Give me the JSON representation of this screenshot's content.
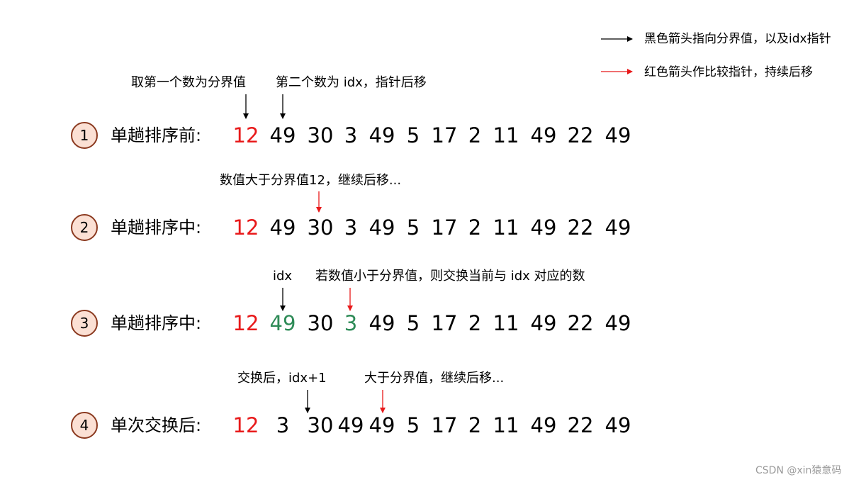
{
  "colors": {
    "pivot": "#e8191a",
    "swap": "#2e8b57",
    "black_arrow": "#000000",
    "red_arrow": "#e8191a",
    "circle_fill": "#fbe0d4",
    "circle_border": "#8b3a20"
  },
  "legend": {
    "black": "黑色箭头指向分界值，以及idx指针",
    "red": "红色箭头作比较指针，持续后移"
  },
  "annotations": {
    "row1_pivot": "取第一个数为分界值",
    "row1_idx": "第二个数为 idx，指针后移",
    "row2_compare": "数值大于分界值12，继续后移...",
    "row3_idx": "idx",
    "row3_compare": "若数值小于分界值，则交换当前与 idx 对应的数",
    "row4_idx": "交换后，idx+1",
    "row4_compare": "大于分界值，继续后移..."
  },
  "rows": [
    {
      "step": "1",
      "label": "单趟排序前:",
      "numbers": [
        "12",
        "49",
        "30",
        "3",
        "49",
        "5",
        "17",
        "2",
        "11",
        "49",
        "22",
        "49"
      ]
    },
    {
      "step": "2",
      "label": "单趟排序中:",
      "numbers": [
        "12",
        "49",
        "30",
        "3",
        "49",
        "5",
        "17",
        "2",
        "11",
        "49",
        "22",
        "49"
      ]
    },
    {
      "step": "3",
      "label": "单趟排序中:",
      "numbers": [
        "12",
        "49",
        "30",
        "3",
        "49",
        "5",
        "17",
        "2",
        "11",
        "49",
        "22",
        "49"
      ]
    },
    {
      "step": "4",
      "label": "单次交换后:",
      "numbers": [
        "12",
        "3",
        "30",
        "49",
        "49",
        "5",
        "17",
        "2",
        "11",
        "49",
        "22",
        "49"
      ]
    }
  ],
  "watermark": "CSDN @xin猿意码"
}
